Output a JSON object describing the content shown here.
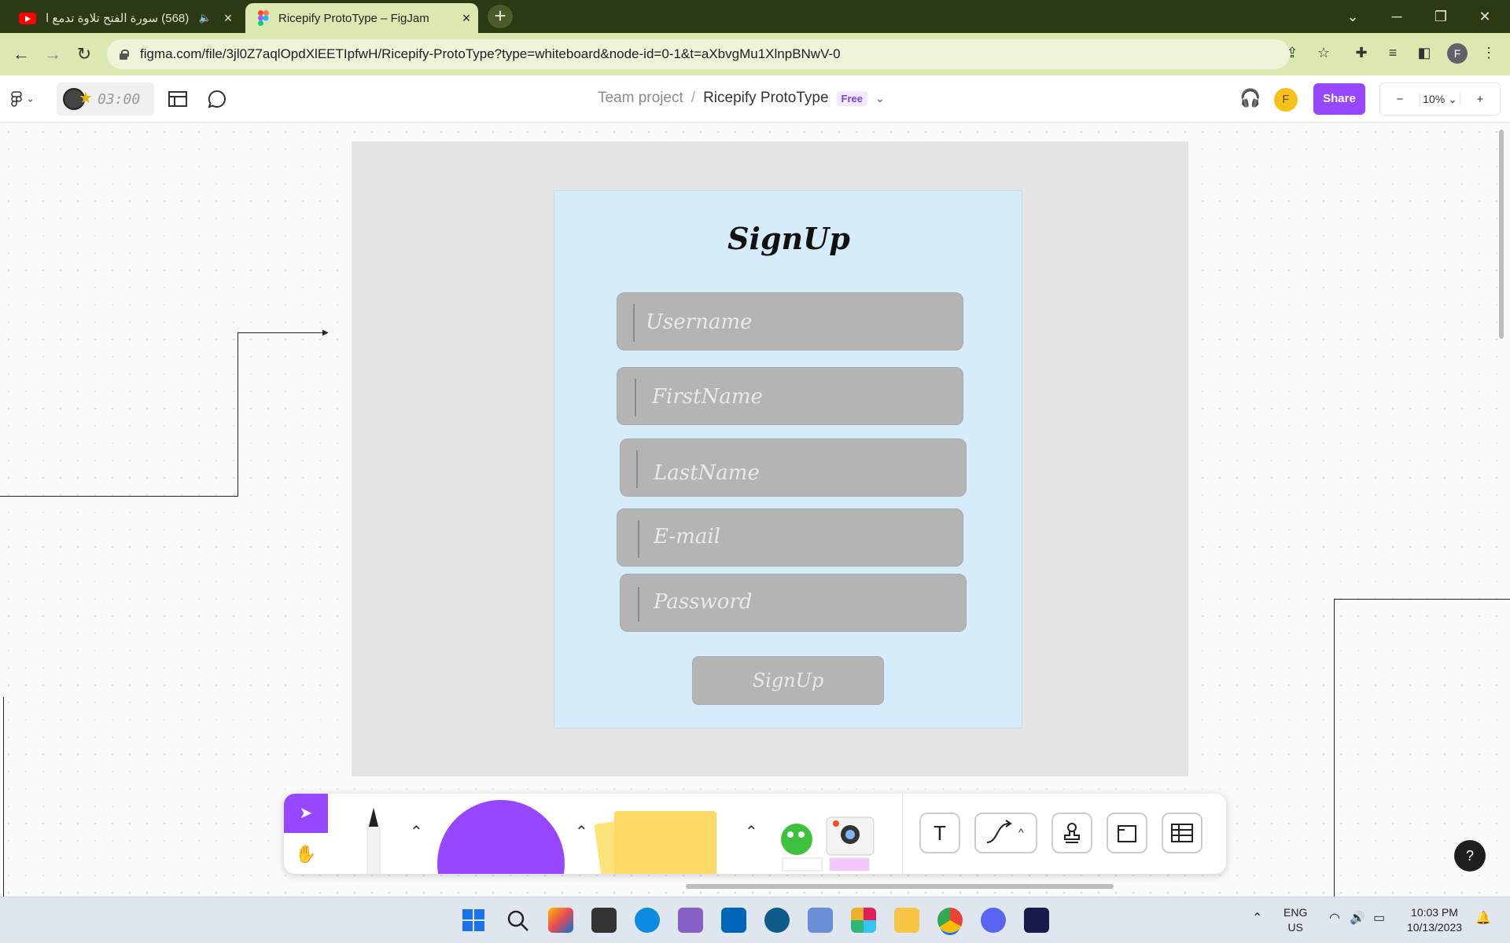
{
  "browser": {
    "tabs": [
      {
        "label": "(568) سورة الفتح تلاوة تدمع ا",
        "icon": "youtube-icon",
        "active": false
      },
      {
        "label": "Ricepify ProtoType – FigJam",
        "icon": "figma-icon",
        "active": true
      }
    ],
    "new_tab": "+",
    "url": "figma.com/file/3jl0Z7aqlOpdXlEETIpfwH/Ricepify-ProtoType?type=whiteboard&node-id=0-1&t=aXbvgMu1XlnpBNwV-0",
    "profile_initial": "F"
  },
  "figjam": {
    "timer": "03:00",
    "breadcrumb": {
      "team": "Team project",
      "separator": "/",
      "project": "Ricepify ProtoType",
      "badge": "Free"
    },
    "user_initial": "F",
    "share_label": "Share",
    "zoom": {
      "minus": "−",
      "level": "10%",
      "plus": "+"
    },
    "help": "?"
  },
  "prototype": {
    "title": "SignUp",
    "fields": [
      {
        "placeholder": "Username"
      },
      {
        "placeholder": "FirstName"
      },
      {
        "placeholder": "LastName"
      },
      {
        "placeholder": "E-mail"
      },
      {
        "placeholder": "Password"
      }
    ],
    "submit_label": "SignUp"
  },
  "toolbar": {
    "tools": [
      "select-tool",
      "hand-tool",
      "marker-tool",
      "shape-tool",
      "sticky-note-tool",
      "stickers-tool",
      "text-tool",
      "connector-tool",
      "stamp-tool",
      "section-tool",
      "table-tool"
    ],
    "text_glyph": "T"
  },
  "taskbar": {
    "lang_line1": "ENG",
    "lang_line2": "US",
    "time": "10:03 PM",
    "date": "10/13/2023"
  },
  "colors": {
    "accent": "#9747ff",
    "browser_frame": "#2b3a12",
    "browser_active": "#dbe9b0",
    "panel_bg": "#d6ecfb",
    "field_bg": "#b4b4b4",
    "user_avatar": "#f6c21a"
  }
}
